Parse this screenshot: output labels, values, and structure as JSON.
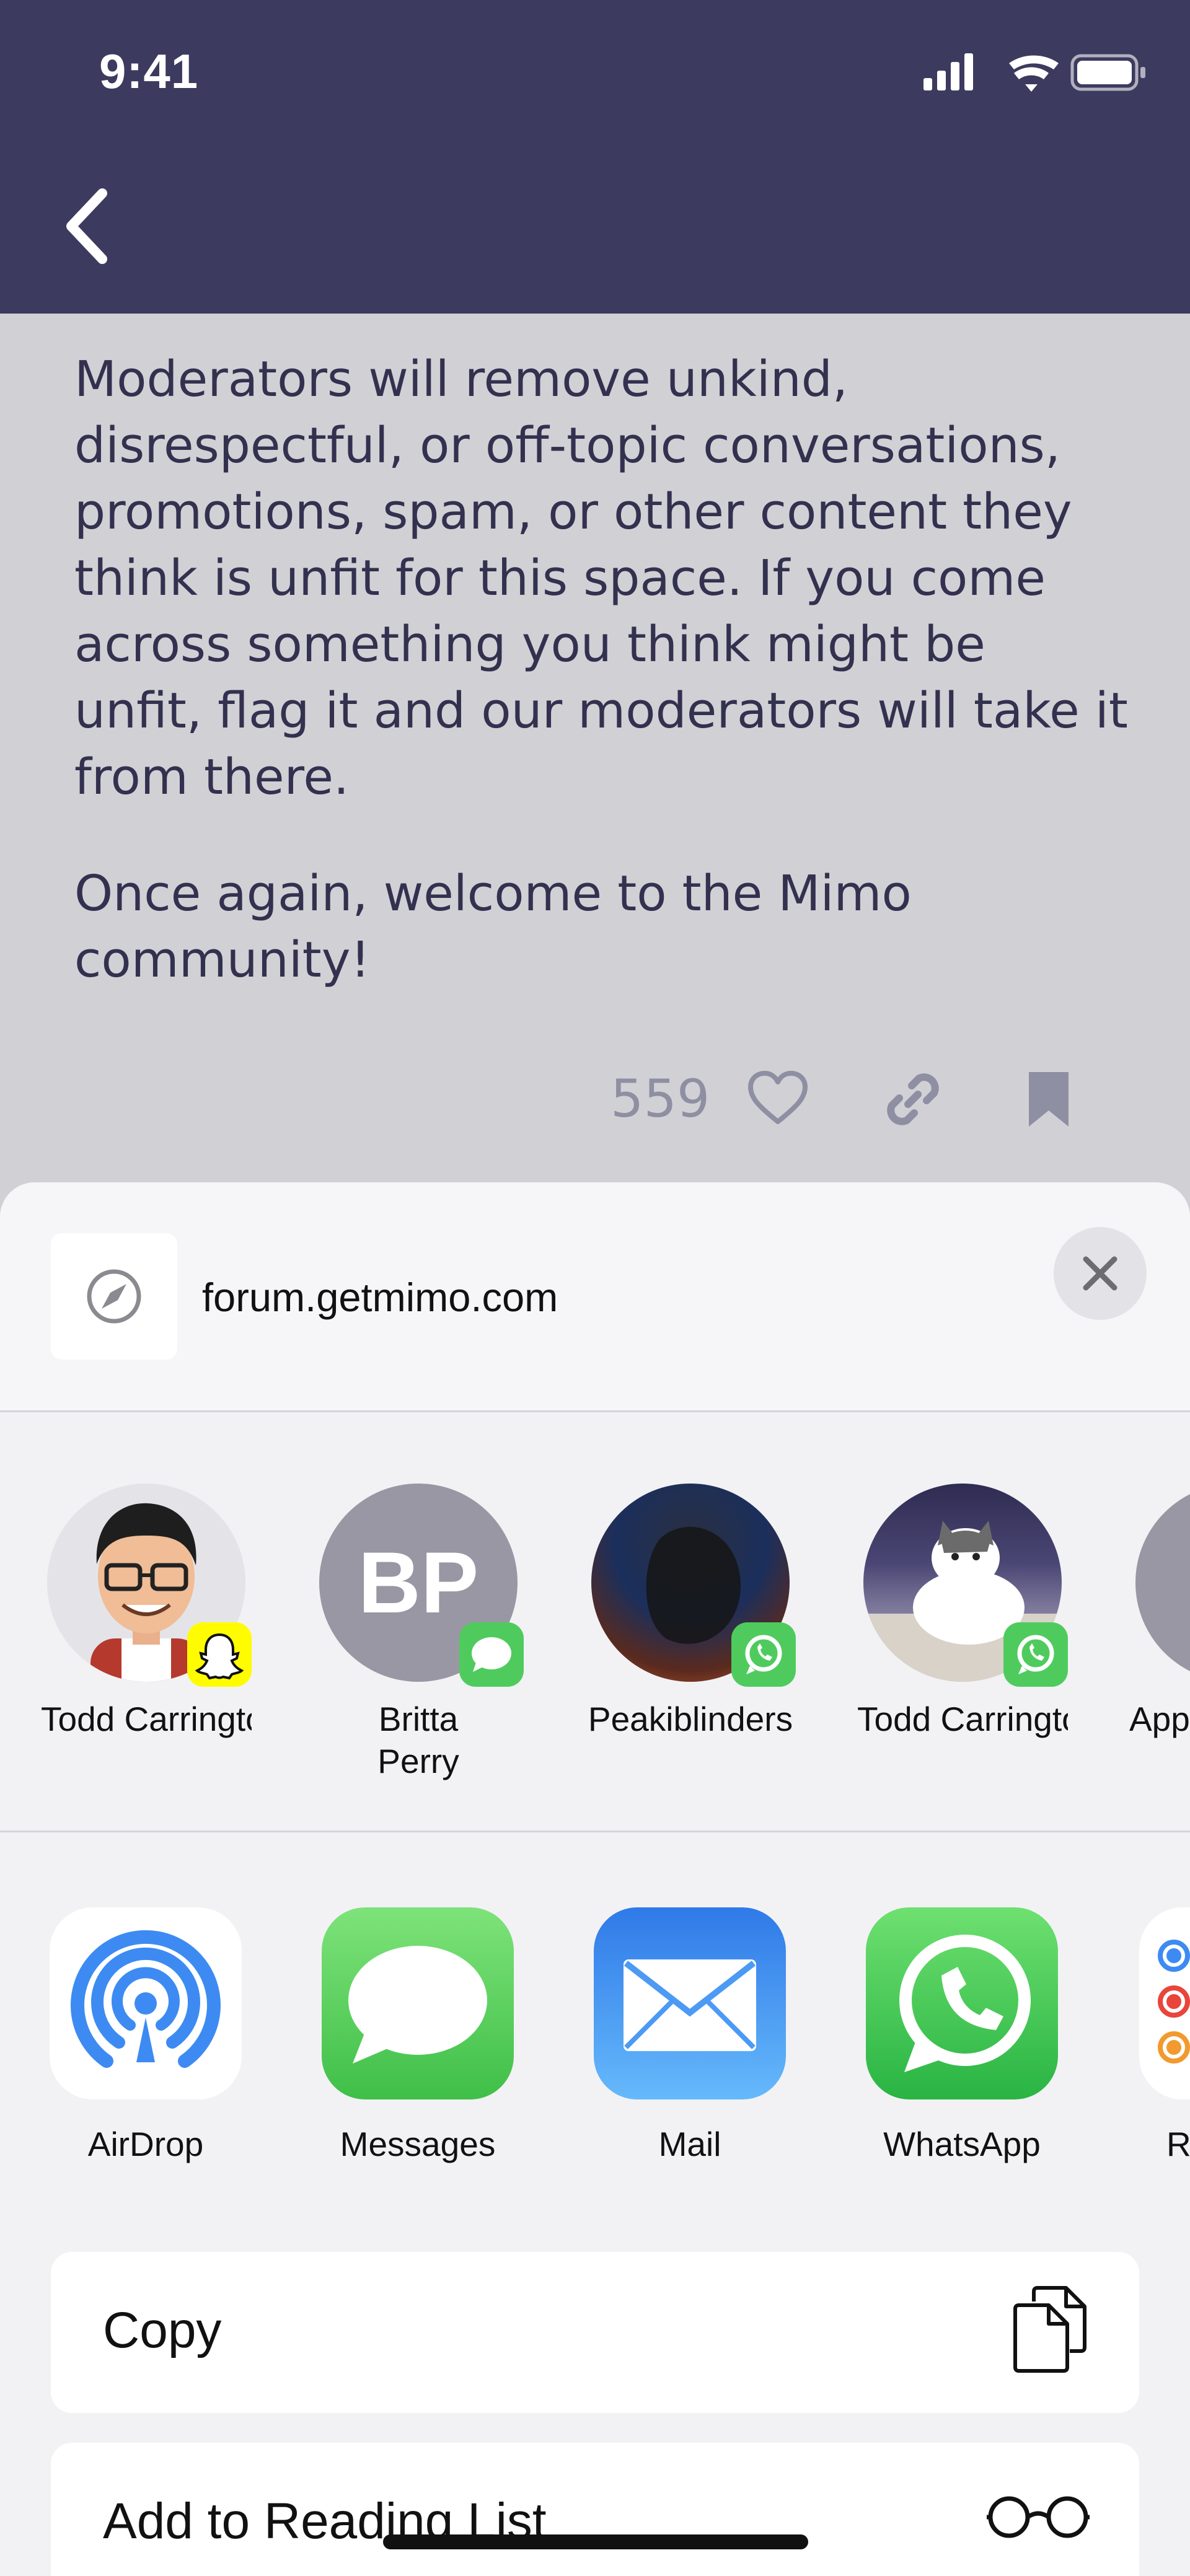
{
  "status_bar": {
    "time": "9:41"
  },
  "article": {
    "paragraph1": "Moderators will remove unkind, disrespectful, or off-topic conversations, promotions, spam, or other content they think is unfit for this space. If you come across something you think might be unfit, flag it and our moderators will take it from there.",
    "paragraph2": "Once again, welcome to the Mimo community!",
    "like_count": "559"
  },
  "share_sheet": {
    "site": "forum.getmimo.com",
    "contacts": [
      {
        "name": "Todd Carringtonbe...",
        "badge": "snapchat"
      },
      {
        "name": "Britta Perry",
        "initials": "BP",
        "badge": "messages"
      },
      {
        "name": "Peakiblinders",
        "badge": "whatsapp"
      },
      {
        "name": "Todd Carringtonbe...",
        "badge": "whatsapp"
      },
      {
        "name": "App"
      }
    ],
    "apps": [
      {
        "name": "AirDrop"
      },
      {
        "name": "Messages"
      },
      {
        "name": "Mail"
      },
      {
        "name": "WhatsApp"
      },
      {
        "name": "Re"
      }
    ],
    "actions": [
      {
        "label": "Copy",
        "icon": "copy-icon"
      },
      {
        "label": "Add to Reading List",
        "icon": "glasses-icon"
      }
    ]
  },
  "colors": {
    "nav_bar": "#3c3a5e",
    "text": "#33314f",
    "icon_grey": "#8f8fa3",
    "whatsapp_green": "#4fcb5e",
    "mail_blue": "#3d8bf2"
  }
}
